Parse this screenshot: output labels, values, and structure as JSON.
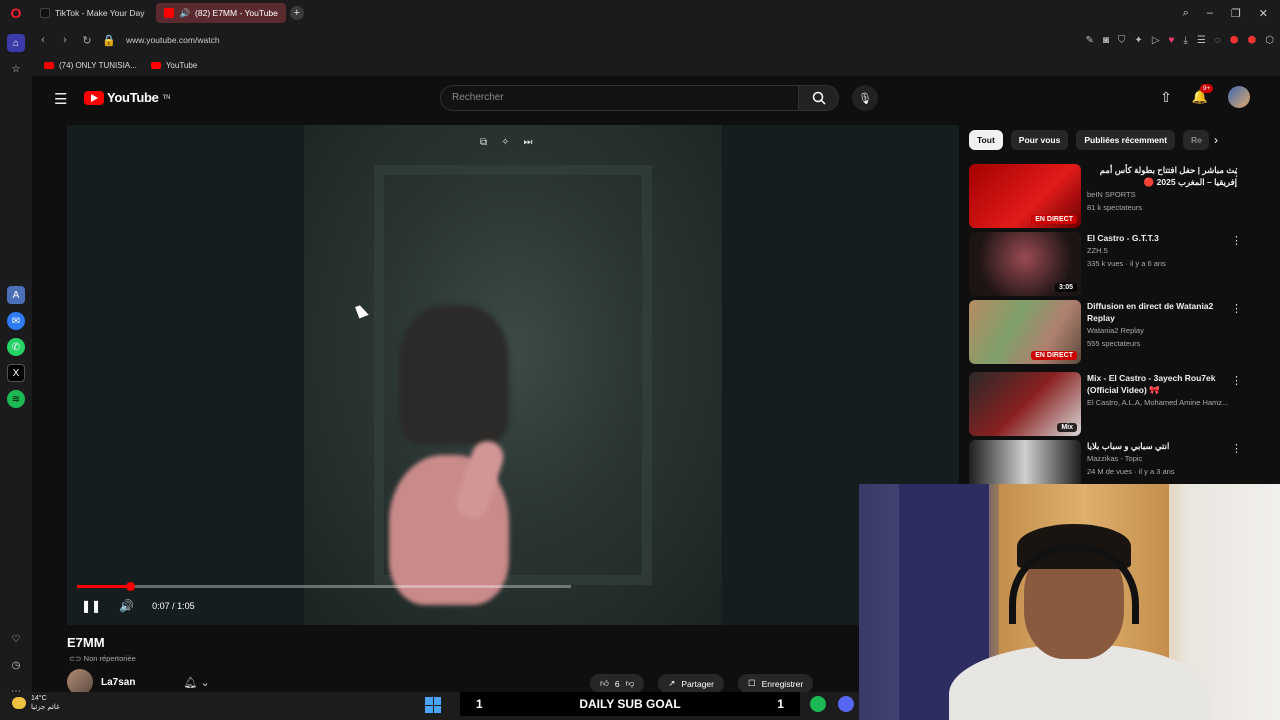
{
  "browser": {
    "tabs": [
      {
        "label": "TikTok - Make Your Day"
      },
      {
        "label": "(82) E7MM - YouTube",
        "active": true
      }
    ],
    "url": "www.youtube.com/watch",
    "bookmarks": [
      {
        "label": "(74) ONLY TUNISIA..."
      },
      {
        "label": "YouTube"
      }
    ]
  },
  "youtube": {
    "logo": "YouTube",
    "logo_region": "TN",
    "search_placeholder": "Rechercher",
    "notif_count": "9+"
  },
  "player": {
    "time": "0:07 / 1:05",
    "progress_fraction": 0.108
  },
  "video": {
    "title": "E7MM",
    "visibility": "Non répertoriée",
    "channel": "La7san",
    "likes": "6",
    "share_label": "Partager",
    "save_label": "Enregistrer"
  },
  "chips": [
    "Tout",
    "Pour vous",
    "Publiées récemment",
    "Re"
  ],
  "recommendations": [
    {
      "title": "بث مباشر | حفل افتتاح بطولة كأس أمم إفريقيا – المغرب 2025 🔴",
      "channel": "beIN SPORTS",
      "meta": "81 k spectateurs",
      "badge": "EN DIRECT",
      "live": true
    },
    {
      "title": "El Castro - G.T.T.3",
      "channel": "ZZH.5",
      "meta": "335 k vues · il y a 6 ans",
      "badge": "3:05",
      "live": false
    },
    {
      "title": "Diffusion en direct de Watania2 Replay",
      "channel": "Watania2 Replay",
      "meta": "555 spectateurs",
      "badge": "EN DIRECT",
      "live": true
    },
    {
      "title": "Mix - El Castro - 3ayech Rou7ek (Official Video) 🎀",
      "channel": "El Castro, A.L.A, Mohamed Amine Hamz...",
      "meta": "",
      "badge": "Mix",
      "live": false
    },
    {
      "title": "انتي سبابي و سباب بلايا",
      "channel": "Mazzikas - Topic",
      "meta": "24 M de vues · il y a 3 ans",
      "badge": "",
      "live": false
    }
  ],
  "taskbar": {
    "temp": "14°C",
    "weather_text": "غائم جزئيا",
    "goal_left": "1",
    "goal_label": "DAILY SUB GOAL",
    "goal_right": "1"
  }
}
